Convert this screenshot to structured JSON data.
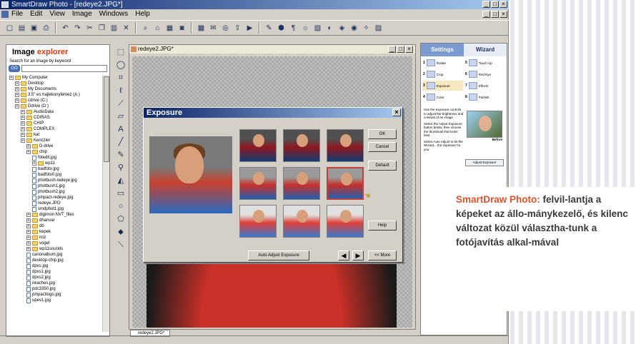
{
  "window": {
    "title": "SmartDraw Photo - [redeye2.JPG*]",
    "menu": [
      "File",
      "Edit",
      "View",
      "Image",
      "Windows",
      "Help"
    ]
  },
  "explorer": {
    "title_plain": "Image",
    "title_accent": "explorer",
    "search_label": "Search for an image by keyword",
    "go_label": "GO",
    "tree": [
      {
        "label": "My Computer",
        "type": "folder",
        "indent": 0
      },
      {
        "label": "Desktop",
        "type": "folder",
        "indent": 1
      },
      {
        "label": "My Documents",
        "type": "folder",
        "indent": 1
      },
      {
        "label": "3.5\" es hajlékonylemez (A:)",
        "type": "folder",
        "indent": 1
      },
      {
        "label": "cdrive (C:)",
        "type": "folder",
        "indent": 1
      },
      {
        "label": "Ddrive (D:)",
        "type": "folder",
        "indent": 1
      },
      {
        "label": "AudioData",
        "type": "folder",
        "indent": 2
      },
      {
        "label": "CDIRAS",
        "type": "folder",
        "indent": 2
      },
      {
        "label": "CHIP",
        "type": "folder",
        "indent": 2
      },
      {
        "label": "COMPLEX",
        "type": "folder",
        "indent": 2
      },
      {
        "label": "kat",
        "type": "folder",
        "indent": 2
      },
      {
        "label": "Kenczler",
        "type": "folder",
        "indent": 2
      },
      {
        "label": "D-drive",
        "type": "folder",
        "indent": 3
      },
      {
        "label": "chip",
        "type": "folder",
        "indent": 3
      },
      {
        "label": "fotedit.jpg",
        "type": "file",
        "indent": 4
      },
      {
        "label": "wp11",
        "type": "folder",
        "indent": 4
      },
      {
        "label": "badfoto.jpg",
        "type": "file",
        "indent": 4
      },
      {
        "label": "badfoto0.jpg",
        "type": "file",
        "indent": 4
      },
      {
        "label": "photbush-redeye.jpg",
        "type": "file",
        "indent": 4
      },
      {
        "label": "photbush1.jpg",
        "type": "file",
        "indent": 4
      },
      {
        "label": "photbush2.jpg",
        "type": "file",
        "indent": 4
      },
      {
        "label": "pinpact-redeye.jpg",
        "type": "file",
        "indent": 4
      },
      {
        "label": "redeye.JPG",
        "type": "file",
        "indent": 4
      },
      {
        "label": "smdphot1.jpg",
        "type": "file",
        "indent": 4
      },
      {
        "label": "digimon NVT_files",
        "type": "folder",
        "indent": 3
      },
      {
        "label": "dhanvar",
        "type": "folder",
        "indent": 3
      },
      {
        "label": "db",
        "type": "folder",
        "indent": 3
      },
      {
        "label": "kepek",
        "type": "folder",
        "indent": 3
      },
      {
        "label": "noz",
        "type": "folder",
        "indent": 3
      },
      {
        "label": "vogel",
        "type": "folder",
        "indent": 3
      },
      {
        "label": "wp11sounds",
        "type": "folder",
        "indent": 3
      },
      {
        "label": "canonalbum.jpg",
        "type": "file",
        "indent": 3
      },
      {
        "label": "desktop-chip.jpg",
        "type": "file",
        "indent": 3
      },
      {
        "label": "dpxs.jpg",
        "type": "file",
        "indent": 3
      },
      {
        "label": "dpxs1.jpg",
        "type": "file",
        "indent": 3
      },
      {
        "label": "dpxs2.jpg",
        "type": "file",
        "indent": 3
      },
      {
        "label": "nkaches.jpg",
        "type": "file",
        "indent": 3
      },
      {
        "label": "pdc3350.jpg",
        "type": "file",
        "indent": 3
      },
      {
        "label": "pinpactlogo.jpg",
        "type": "file",
        "indent": 3
      },
      {
        "label": "upev1.jpg",
        "type": "file",
        "indent": 3
      }
    ]
  },
  "document": {
    "title": "redeye2.JPG*",
    "tab_label": "redeye2.JPG*"
  },
  "dialog": {
    "title": "Exposure",
    "ok_label": "OK",
    "cancel_label": "Cancel",
    "default_label": "Default",
    "help_label": "Help",
    "auto_adjust_label": "Auto Adjust Exposure",
    "more_label": "<< More"
  },
  "right_panel": {
    "tab_settings": "Settings",
    "tab_wizard": "Wizard",
    "steps": [
      {
        "num": "1",
        "label": "Rotate"
      },
      {
        "num": "5",
        "label": "Touch Up"
      },
      {
        "num": "2",
        "label": "Crop"
      },
      {
        "num": "6",
        "label": "Red Eye"
      },
      {
        "num": "3",
        "label": "Exposure"
      },
      {
        "num": "7",
        "label": "Effects"
      },
      {
        "num": "4",
        "label": "Color"
      },
      {
        "num": "8",
        "label": "Publish"
      }
    ],
    "text_1": "Use the exposure controls to adjust the brightness and contrast of an image.",
    "text_2": "Select the Adjust Exposure button below, then choose the thumbnail that looks best.",
    "text_3": "Select Auto Adjust to let the Wizard... the exposure for you.",
    "before_label": "Before",
    "adjust_button": "Adjust Exposure"
  },
  "caption": {
    "lead": "SmartDraw Photo:",
    "body": "felvil-lantja a képeket az állo-mánykezelő, és kilenc változat közül választha-tunk a fotójavítás alkal-mával"
  }
}
